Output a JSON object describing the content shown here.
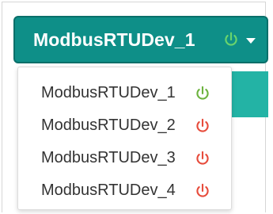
{
  "selector": {
    "current_device": "ModbusRTUDev_1",
    "current_status_icon": "power-icon",
    "current_status_color": "#69d46d",
    "caret_icon": "caret-down-icon"
  },
  "dropdown": {
    "items": [
      {
        "label": "ModbusRTUDev_1",
        "status_icon": "power-icon",
        "status_color": "#6db33f"
      },
      {
        "label": "ModbusRTUDev_2",
        "status_icon": "power-icon",
        "status_color": "#e74c3c"
      },
      {
        "label": "ModbusRTUDev_3",
        "status_icon": "power-icon",
        "status_color": "#e74c3c"
      },
      {
        "label": "ModbusRTUDev_4",
        "status_icon": "power-icon",
        "status_color": "#e74c3c"
      }
    ]
  },
  "colors": {
    "button_bg": "#0e8f88",
    "button_border": "#0a6f6a",
    "backdrop_teal": "#23b3a5",
    "menu_text": "#333333"
  }
}
